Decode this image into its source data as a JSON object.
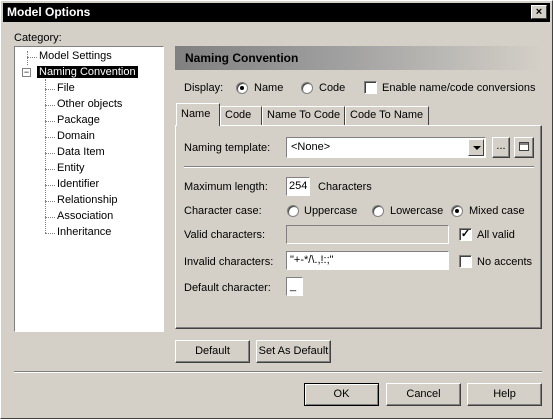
{
  "window": {
    "title": "Model Options",
    "close_glyph": "×"
  },
  "category": {
    "label": "Category:",
    "items": [
      {
        "label": "Model Settings"
      },
      {
        "label": "Naming Convention"
      },
      {
        "label": "File"
      },
      {
        "label": "Other objects"
      },
      {
        "label": "Package"
      },
      {
        "label": "Domain"
      },
      {
        "label": "Data Item"
      },
      {
        "label": "Entity"
      },
      {
        "label": "Identifier"
      },
      {
        "label": "Relationship"
      },
      {
        "label": "Association"
      },
      {
        "label": "Inheritance"
      }
    ],
    "collapse_glyph": "−"
  },
  "panel": {
    "header": "Naming Convention",
    "display_label": "Display:",
    "display_options": [
      {
        "label": "Name",
        "selected": true
      },
      {
        "label": "Code",
        "selected": false
      }
    ],
    "enable_conversions": {
      "label": "Enable name/code conversions",
      "checked": false
    },
    "tabs": [
      {
        "label": "Name",
        "active": true
      },
      {
        "label": "Code",
        "active": false
      },
      {
        "label": "Name To Code",
        "active": false
      },
      {
        "label": "Code To Name",
        "active": false
      }
    ],
    "naming_template": {
      "label": "Naming template:",
      "value": "<None>",
      "ellipsis": "..."
    },
    "max_length": {
      "label": "Maximum length:",
      "value": "254",
      "unit": "Characters"
    },
    "character_case": {
      "label": "Character case:",
      "options": [
        {
          "label": "Uppercase",
          "selected": false
        },
        {
          "label": "Lowercase",
          "selected": false
        },
        {
          "label": "Mixed case",
          "selected": true
        }
      ]
    },
    "valid_characters": {
      "label": "Valid characters:",
      "value": "",
      "all_valid_label": "All valid",
      "all_valid_checked": true
    },
    "invalid_characters": {
      "label": "Invalid characters:",
      "value": "\"+-*/\\.,!:;\"",
      "no_accents_label": "No accents",
      "no_accents_checked": false
    },
    "default_character": {
      "label": "Default character:",
      "value": "_"
    }
  },
  "buttons": {
    "default": "Default",
    "set_as_default": "Set As Default",
    "ok": "OK",
    "cancel": "Cancel",
    "help": "Help"
  },
  "colors": {
    "header_gradient_start": "#808080",
    "header_gradient_end": "#d4d0c8"
  }
}
